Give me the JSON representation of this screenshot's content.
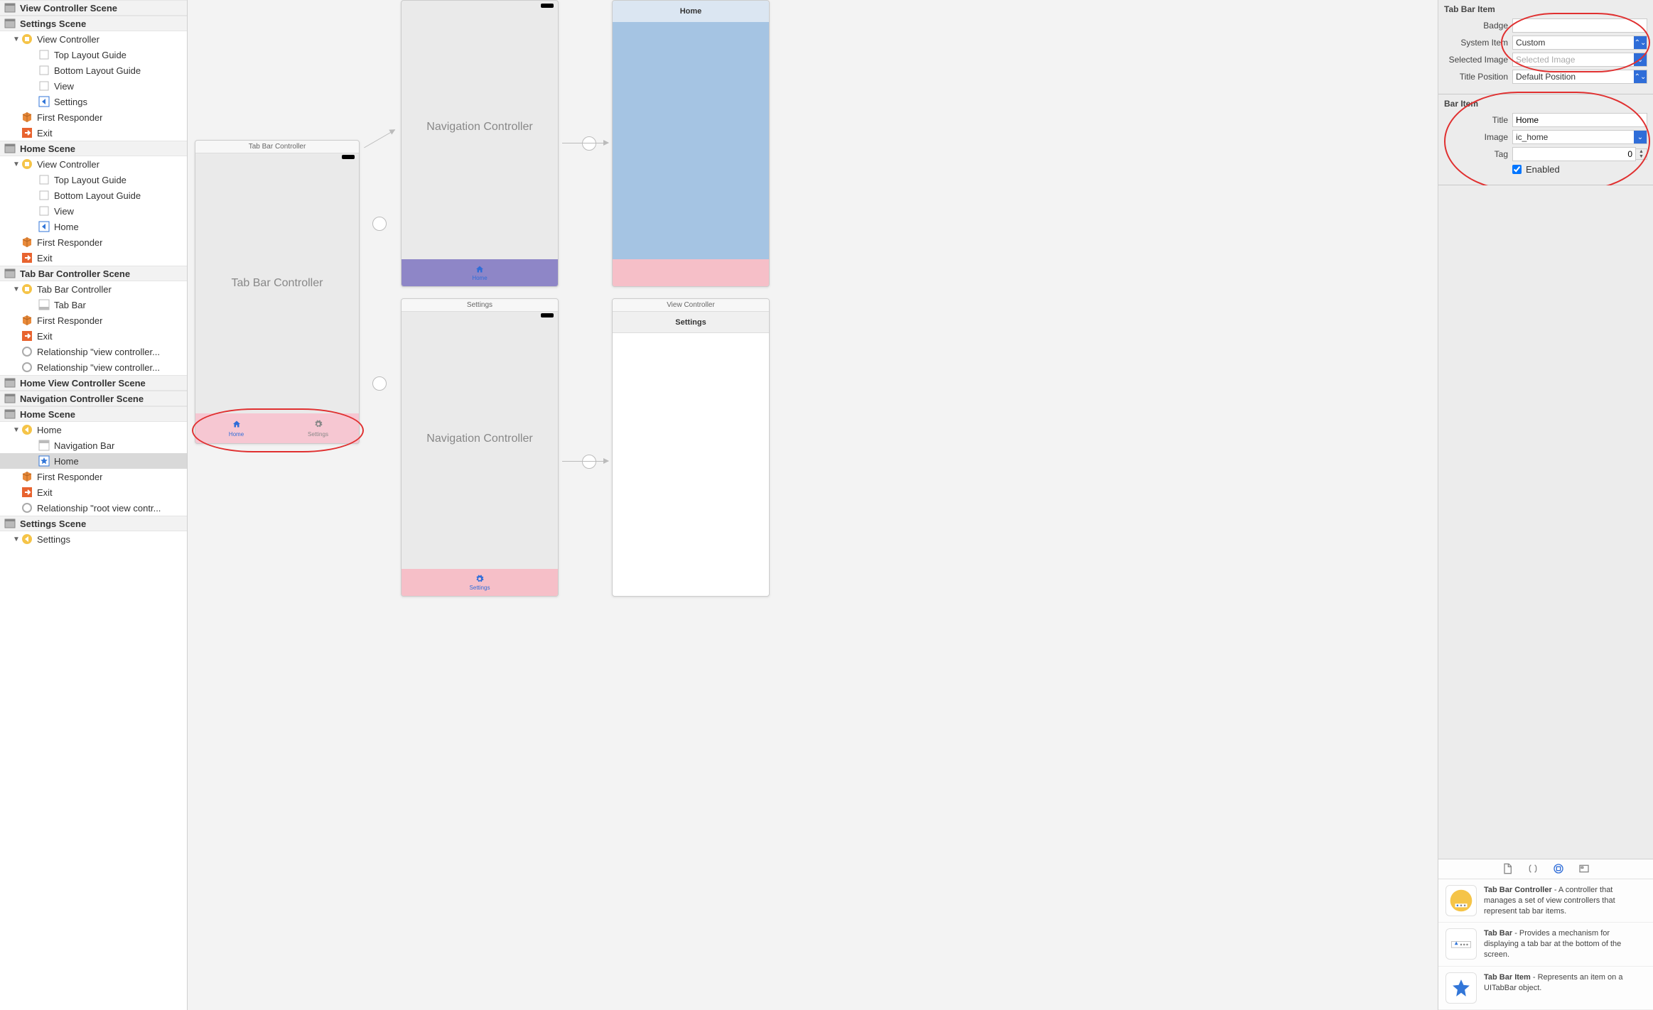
{
  "outline": {
    "scenes": [
      {
        "label": "View Controller Scene",
        "items": []
      },
      {
        "label": "Settings Scene",
        "items": [
          {
            "label": "View Controller",
            "indent": 1,
            "icon": "vc-yellow",
            "disclosure": "down"
          },
          {
            "label": "Top Layout Guide",
            "indent": 2,
            "icon": "guide"
          },
          {
            "label": "Bottom Layout Guide",
            "indent": 2,
            "icon": "guide"
          },
          {
            "label": "View",
            "indent": 2,
            "icon": "guide"
          },
          {
            "label": "Settings",
            "indent": 2,
            "icon": "back"
          },
          {
            "label": "First Responder",
            "indent": 1,
            "icon": "cube"
          },
          {
            "label": "Exit",
            "indent": 1,
            "icon": "exit"
          }
        ]
      },
      {
        "label": "Home Scene",
        "items": [
          {
            "label": "View Controller",
            "indent": 1,
            "icon": "vc-yellow",
            "disclosure": "down"
          },
          {
            "label": "Top Layout Guide",
            "indent": 2,
            "icon": "guide"
          },
          {
            "label": "Bottom Layout Guide",
            "indent": 2,
            "icon": "guide"
          },
          {
            "label": "View",
            "indent": 2,
            "icon": "guide"
          },
          {
            "label": "Home",
            "indent": 2,
            "icon": "back"
          },
          {
            "label": "First Responder",
            "indent": 1,
            "icon": "cube"
          },
          {
            "label": "Exit",
            "indent": 1,
            "icon": "exit"
          }
        ]
      },
      {
        "label": "Tab Bar Controller Scene",
        "items": [
          {
            "label": "Tab Bar Controller",
            "indent": 1,
            "icon": "vc-yellow",
            "disclosure": "down"
          },
          {
            "label": "Tab Bar",
            "indent": 2,
            "icon": "tabbar"
          },
          {
            "label": "First Responder",
            "indent": 1,
            "icon": "cube"
          },
          {
            "label": "Exit",
            "indent": 1,
            "icon": "exit"
          },
          {
            "label": "Relationship \"view controller...",
            "indent": 1,
            "icon": "rel"
          },
          {
            "label": "Relationship \"view controller...",
            "indent": 1,
            "icon": "rel"
          }
        ]
      },
      {
        "label": "Home View Controller Scene",
        "items": []
      },
      {
        "label": "Navigation Controller Scene",
        "items": []
      },
      {
        "label": "Home Scene",
        "items": [
          {
            "label": "Home",
            "indent": 1,
            "icon": "vc-back-y",
            "disclosure": "down"
          },
          {
            "label": "Navigation Bar",
            "indent": 2,
            "icon": "navbar"
          },
          {
            "label": "Home",
            "indent": 2,
            "icon": "star",
            "selected": true
          },
          {
            "label": "First Responder",
            "indent": 1,
            "icon": "cube"
          },
          {
            "label": "Exit",
            "indent": 1,
            "icon": "exit"
          },
          {
            "label": "Relationship \"root view contr...",
            "indent": 1,
            "icon": "rel"
          }
        ]
      },
      {
        "label": "Settings Scene",
        "items": [
          {
            "label": "Settings",
            "indent": 1,
            "icon": "vc-back-y",
            "disclosure": "down",
            "cutoff": true
          }
        ]
      }
    ]
  },
  "canvas": {
    "tabbar_vc_title": "Tab Bar Controller",
    "tabbar_vc_big": "Tab Bar Controller",
    "tab_home": "Home",
    "tab_settings": "Settings",
    "nav1_big": "Navigation Controller",
    "nav1_tab": "Home",
    "nav2_title": "Settings",
    "nav2_big": "Navigation Controller",
    "nav2_tab": "Settings",
    "home_vc_title": "Home",
    "settings_vc_title": "View Controller",
    "settings_vc_nav": "Settings"
  },
  "inspector": {
    "tabbar_item_header": "Tab Bar Item",
    "badge_label": "Badge",
    "badge_value": "",
    "system_item_label": "System Item",
    "system_item_value": "Custom",
    "selected_image_label": "Selected Image",
    "selected_image_placeholder": "Selected Image",
    "title_position_label": "Title Position",
    "title_position_value": "Default Position",
    "bar_item_header": "Bar Item",
    "title_label": "Title",
    "title_value": "Home",
    "image_label": "Image",
    "image_value": "ic_home",
    "tag_label": "Tag",
    "tag_value": "0",
    "enabled_label": "Enabled",
    "enabled_checked": true
  },
  "library": {
    "items": [
      {
        "title": "Tab Bar Controller",
        "desc": " - A controller that manages a set of view controllers that represent tab bar items.",
        "icon": "tbc"
      },
      {
        "title": "Tab Bar",
        "desc": " - Provides a mechanism for displaying a tab bar at the bottom of the screen.",
        "icon": "tb"
      },
      {
        "title": "Tab Bar Item",
        "desc": " - Represents an item on a UITabBar object.",
        "icon": "tbi"
      }
    ]
  }
}
